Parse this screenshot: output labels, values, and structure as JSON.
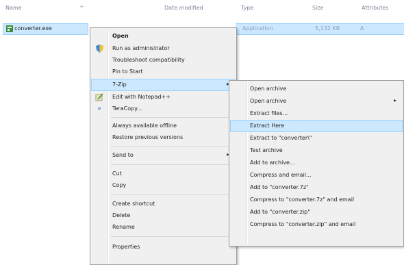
{
  "columns": {
    "name": "Name",
    "date_modified": "Date modified",
    "type": "Type",
    "size": "Size",
    "attributes": "Attributes"
  },
  "file": {
    "name": "converter.exe",
    "type": "Application",
    "size": "5,132 KB",
    "attributes": "A"
  },
  "context_menu": {
    "open": "Open",
    "run_as_admin": "Run as administrator",
    "troubleshoot": "Troubleshoot compatibility",
    "pin_to_start": "Pin to Start",
    "seven_zip": "7-Zip",
    "edit_notepad": "Edit with Notepad++",
    "teracopy": "TeraCopy...",
    "always_offline": "Always available offline",
    "restore_versions": "Restore previous versions",
    "send_to": "Send to",
    "cut": "Cut",
    "copy": "Copy",
    "create_shortcut": "Create shortcut",
    "delete": "Delete",
    "rename": "Rename",
    "properties": "Properties"
  },
  "submenu_7zip": {
    "items": [
      "Open archive",
      "Open archive",
      "Extract files...",
      "Extract Here",
      "Extract to \"converter\\\"",
      "Test archive",
      "Add to archive...",
      "Compress and email...",
      "Add to \"converter.7z\"",
      "Compress to \"converter.7z\" and email",
      "Add to \"converter.zip\"",
      "Compress to \"converter.zip\" and email"
    ]
  },
  "colors": {
    "highlight": "#cce8ff",
    "highlight_border": "#99d1ff",
    "menu_bg": "#f0f0f0"
  },
  "icons": {
    "file": "application-icon",
    "run_as_admin": "shield-icon",
    "notepad": "notepad-icon",
    "teracopy": "teracopy-icon"
  }
}
